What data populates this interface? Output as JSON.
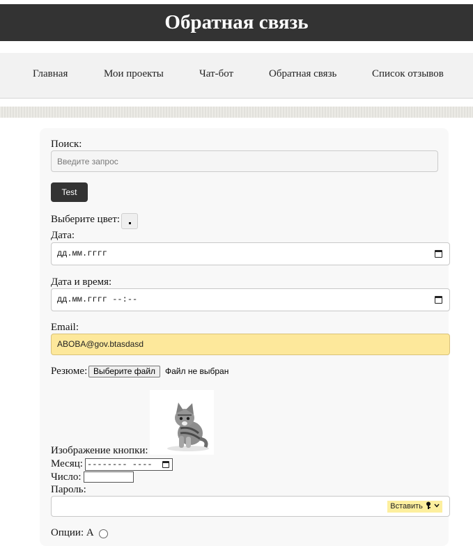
{
  "header": {
    "title": "Обратная связь"
  },
  "nav": {
    "items": [
      "Главная",
      "Мои проекты",
      "Чат-бот",
      "Обратная связь",
      "Список отзывов"
    ]
  },
  "form": {
    "search_label": "Поиск:",
    "search_placeholder": "Введите запрос",
    "test_button": "Test",
    "color_label": "Выберите цвет:",
    "date_label": "Дата:",
    "date_placeholder": "дд.мм.гггг",
    "datetime_label": "Дата и время:",
    "datetime_placeholder": "дд.мм.гггг --:--",
    "email_label": "Email:",
    "email_value": "ABOBA@gov.btasdasd",
    "resume_label": "Резюме:",
    "file_button": "Выберите файл",
    "file_status": "Файл не выбран",
    "image_button_label": "Изображение кнопки:",
    "month_label": "Месяц:",
    "month_placeholder": "-------- ----",
    "number_label": "Число:",
    "password_label": "Пароль:",
    "paste_label": "Вставить",
    "options_label": "Опции: А"
  },
  "colors": {
    "header_bg": "#333333",
    "nav_bg": "#f2f2f2",
    "button_bg": "#333333",
    "autofill_bg": "#fde89b",
    "card_bg": "#f8f8f8"
  }
}
